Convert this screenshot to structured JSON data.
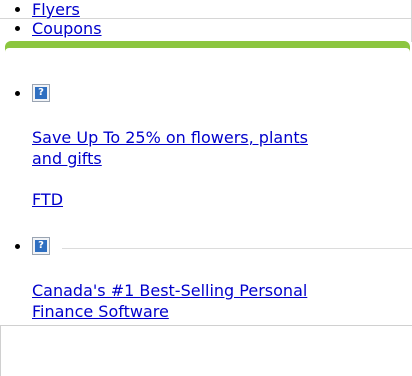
{
  "nav": {
    "items": [
      {
        "label": "Flyers"
      },
      {
        "label": "Coupons"
      }
    ]
  },
  "offers": [
    {
      "image_icon": "missing-image-icon",
      "image_glyph": "?",
      "title": "Save Up To 25% on flowers, plants and gifts",
      "brand": "FTD"
    },
    {
      "image_icon": "missing-image-icon",
      "image_glyph": "?",
      "title": "Canada's #1 Best-Selling Personal Finance Software"
    }
  ],
  "colors": {
    "accent_bar": "#8cc63f",
    "link": "#0000cc"
  }
}
